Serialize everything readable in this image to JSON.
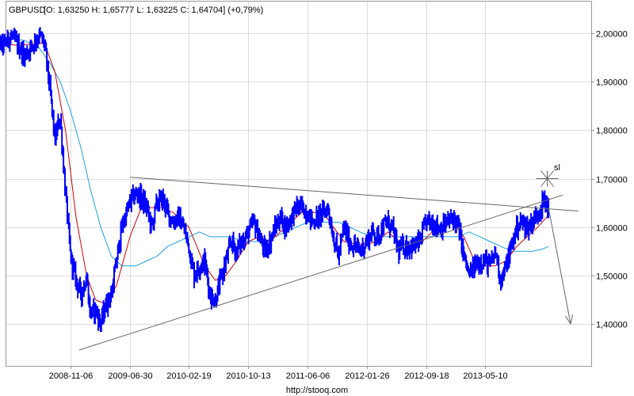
{
  "header": {
    "symbol": "GBPUSD",
    "quote": "[O: 1,63250  H: 1,65777  L: 1,63225  C: 1,64704] (+0,79%)"
  },
  "footer": {
    "source": "http://stooq.com"
  },
  "annotation": {
    "sl_label": "sl"
  },
  "colors": {
    "price": "#0000ff",
    "ma_fast": "#cc0000",
    "ma_slow": "#1ea0e6",
    "trendline": "#666666",
    "grid": "#dcdcdc",
    "axis": "#999999"
  },
  "chart_data": {
    "type": "line",
    "title": "",
    "xlabel": "",
    "ylabel": "",
    "xlim": [
      "2008-01-01",
      "2014-10-31"
    ],
    "ylim": [
      1.33,
      2.05
    ],
    "grid": true,
    "y_axis_position": "right",
    "x_ticks": [
      "2008-11-06",
      "2009-06-30",
      "2010-02-19",
      "2010-10-13",
      "2011-06-06",
      "2012-01-26",
      "2012-09-18",
      "2013-05-10"
    ],
    "y_ticks": [
      "1,40000",
      "1,50000",
      "1,60000",
      "1,70000",
      "1,80000",
      "1,90000",
      "2,00000"
    ],
    "series": [
      {
        "name": "",
        "style": "daily-bars",
        "x": [
          "2008-01-04",
          "2008-02-15",
          "2008-03-14",
          "2008-04-11",
          "2008-05-09",
          "2008-06-06",
          "2008-07-04",
          "2008-07-25",
          "2008-08-15",
          "2008-09-05",
          "2008-09-26",
          "2008-10-17",
          "2008-11-06",
          "2008-11-28",
          "2008-12-19",
          "2009-01-09",
          "2009-01-23",
          "2009-02-13",
          "2009-03-06",
          "2009-03-27",
          "2009-04-17",
          "2009-05-08",
          "2009-05-29",
          "2009-06-30",
          "2009-07-24",
          "2009-08-14",
          "2009-09-04",
          "2009-09-25",
          "2009-10-16",
          "2009-11-06",
          "2009-11-27",
          "2009-12-18",
          "2010-01-08",
          "2010-01-29",
          "2010-02-19",
          "2010-03-12",
          "2010-04-02",
          "2010-04-23",
          "2010-05-14",
          "2010-06-04",
          "2010-06-25",
          "2010-07-16",
          "2010-08-06",
          "2010-08-27",
          "2010-09-17",
          "2010-10-13",
          "2010-11-05",
          "2010-11-26",
          "2010-12-17",
          "2011-01-07",
          "2011-01-28",
          "2011-02-18",
          "2011-03-11",
          "2011-04-01",
          "2011-04-22",
          "2011-05-13",
          "2011-06-06",
          "2011-06-24",
          "2011-07-15",
          "2011-08-05",
          "2011-08-26",
          "2011-09-16",
          "2011-10-07",
          "2011-10-28",
          "2011-11-18",
          "2011-12-09",
          "2011-12-30",
          "2012-01-26",
          "2012-02-17",
          "2012-03-09",
          "2012-03-30",
          "2012-04-20",
          "2012-05-11",
          "2012-06-01",
          "2012-06-22",
          "2012-07-13",
          "2012-08-03",
          "2012-08-24",
          "2012-09-18",
          "2012-10-12",
          "2012-11-02",
          "2012-11-23",
          "2012-12-14",
          "2013-01-04",
          "2013-01-25",
          "2013-02-15",
          "2013-03-08",
          "2013-03-29",
          "2013-04-19",
          "2013-05-10",
          "2013-05-31",
          "2013-06-21",
          "2013-07-12",
          "2013-08-02",
          "2013-08-23",
          "2013-09-13",
          "2013-10-04",
          "2013-10-25",
          "2013-11-15",
          "2013-12-06",
          "2013-12-27",
          "2014-01-17"
        ],
        "values": [
          1.985,
          1.975,
          1.995,
          1.975,
          1.955,
          1.975,
          1.995,
          1.98,
          1.89,
          1.78,
          1.83,
          1.67,
          1.54,
          1.49,
          1.46,
          1.5,
          1.42,
          1.43,
          1.4,
          1.44,
          1.46,
          1.53,
          1.6,
          1.65,
          1.67,
          1.66,
          1.64,
          1.6,
          1.65,
          1.66,
          1.63,
          1.61,
          1.62,
          1.6,
          1.56,
          1.5,
          1.52,
          1.53,
          1.46,
          1.45,
          1.49,
          1.53,
          1.57,
          1.55,
          1.57,
          1.59,
          1.61,
          1.58,
          1.55,
          1.57,
          1.6,
          1.62,
          1.6,
          1.62,
          1.64,
          1.64,
          1.63,
          1.61,
          1.62,
          1.63,
          1.64,
          1.58,
          1.54,
          1.6,
          1.57,
          1.56,
          1.55,
          1.57,
          1.59,
          1.58,
          1.6,
          1.61,
          1.59,
          1.55,
          1.56,
          1.56,
          1.56,
          1.57,
          1.61,
          1.61,
          1.6,
          1.6,
          1.61,
          1.62,
          1.6,
          1.54,
          1.5,
          1.52,
          1.53,
          1.53,
          1.52,
          1.55,
          1.49,
          1.52,
          1.56,
          1.6,
          1.61,
          1.6,
          1.61,
          1.63,
          1.65,
          1.645
        ]
      },
      {
        "name": "",
        "style": "moving-average-fast",
        "x": [
          "2008-01-04",
          "2008-04-11",
          "2008-07-25",
          "2008-09-05",
          "2008-10-17",
          "2008-11-28",
          "2009-01-09",
          "2009-02-13",
          "2009-03-27",
          "2009-05-08",
          "2009-06-30",
          "2009-08-14",
          "2009-09-25",
          "2009-11-06",
          "2009-12-18",
          "2010-02-19",
          "2010-04-23",
          "2010-06-04",
          "2010-07-16",
          "2010-08-27",
          "2010-10-13",
          "2010-11-26",
          "2011-01-07",
          "2011-02-18",
          "2011-04-01",
          "2011-05-13",
          "2011-06-24",
          "2011-08-05",
          "2011-09-16",
          "2011-10-28",
          "2011-12-09",
          "2012-01-26",
          "2012-03-09",
          "2012-04-20",
          "2012-06-01",
          "2012-07-13",
          "2012-08-24",
          "2012-10-12",
          "2012-11-23",
          "2013-01-04",
          "2013-02-15",
          "2013-03-29",
          "2013-05-10",
          "2013-06-21",
          "2013-08-02",
          "2013-09-13",
          "2013-10-25",
          "2013-12-06",
          "2014-01-17"
        ],
        "values": [
          1.98,
          1.975,
          1.98,
          1.92,
          1.8,
          1.62,
          1.5,
          1.45,
          1.44,
          1.48,
          1.58,
          1.64,
          1.64,
          1.64,
          1.63,
          1.6,
          1.52,
          1.49,
          1.5,
          1.53,
          1.57,
          1.58,
          1.57,
          1.59,
          1.61,
          1.63,
          1.63,
          1.63,
          1.6,
          1.57,
          1.565,
          1.565,
          1.57,
          1.59,
          1.57,
          1.56,
          1.565,
          1.59,
          1.6,
          1.61,
          1.58,
          1.53,
          1.52,
          1.52,
          1.53,
          1.56,
          1.58,
          1.6,
          1.625
        ]
      },
      {
        "name": "",
        "style": "moving-average-slow",
        "x": [
          "2008-01-04",
          "2008-03-14",
          "2008-05-09",
          "2008-07-04",
          "2008-08-15",
          "2008-09-26",
          "2008-11-06",
          "2008-12-19",
          "2009-01-23",
          "2009-03-06",
          "2009-04-17",
          "2009-05-29",
          "2009-07-24",
          "2009-09-04",
          "2009-10-16",
          "2009-11-27",
          "2010-01-08",
          "2010-02-19",
          "2010-04-02",
          "2010-05-14",
          "2010-06-25",
          "2010-08-06",
          "2010-09-17",
          "2010-11-05",
          "2010-12-17",
          "2011-01-28",
          "2011-03-11",
          "2011-04-22",
          "2011-06-06",
          "2011-07-15",
          "2011-08-26",
          "2011-10-07",
          "2011-11-18",
          "2011-12-30",
          "2012-02-17",
          "2012-03-30",
          "2012-05-11",
          "2012-06-22",
          "2012-08-03",
          "2012-09-18",
          "2012-11-02",
          "2012-12-14",
          "2013-01-25",
          "2013-03-08",
          "2013-04-19",
          "2013-05-31",
          "2013-07-12",
          "2013-08-23",
          "2013-10-04",
          "2013-11-15",
          "2013-12-27",
          "2014-01-17"
        ],
        "values": [
          1.99,
          1.99,
          1.985,
          1.97,
          1.94,
          1.9,
          1.84,
          1.76,
          1.68,
          1.6,
          1.54,
          1.52,
          1.52,
          1.53,
          1.54,
          1.56,
          1.57,
          1.58,
          1.59,
          1.58,
          1.58,
          1.58,
          1.57,
          1.57,
          1.57,
          1.58,
          1.59,
          1.6,
          1.61,
          1.61,
          1.61,
          1.61,
          1.6,
          1.59,
          1.58,
          1.58,
          1.58,
          1.58,
          1.58,
          1.58,
          1.58,
          1.58,
          1.58,
          1.59,
          1.58,
          1.57,
          1.56,
          1.55,
          1.55,
          1.55,
          1.555,
          1.56
        ]
      }
    ],
    "trendlines": [
      {
        "from": [
          "2009-06-30",
          1.703
        ],
        "to": [
          "2014-05-15",
          1.633
        ]
      },
      {
        "from": [
          "2008-12-10",
          1.346
        ],
        "to": [
          "2014-03-15",
          1.666
        ]
      },
      {
        "from": [
          "2014-01-17",
          1.64
        ],
        "to": [
          "2014-04-15",
          1.4
        ],
        "arrow": true
      }
    ],
    "stop_marker": {
      "x": "2014-01-12",
      "y": 1.7,
      "label": "sl"
    }
  }
}
